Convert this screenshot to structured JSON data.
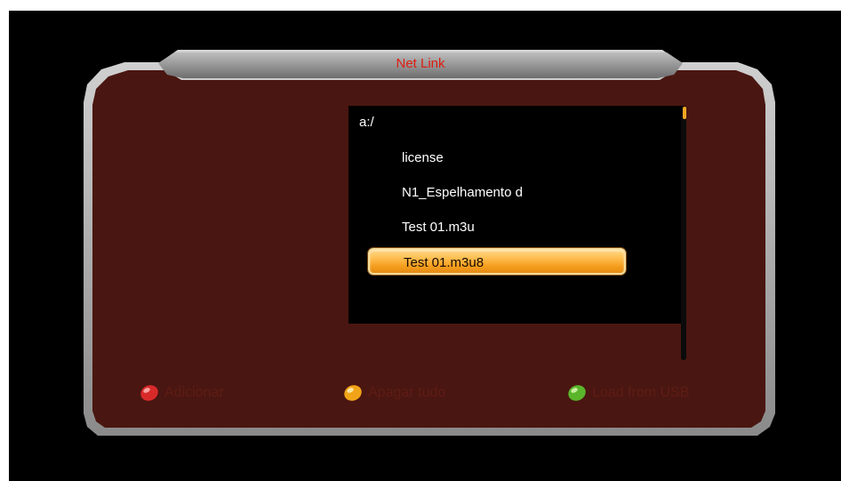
{
  "window": {
    "title": "Net Link"
  },
  "browser": {
    "path": "a:/",
    "files": [
      "license",
      "N1_Espelhamento d",
      "Test 01.m3u",
      "Test 01.m3u8"
    ],
    "selected": "Test 01.m3u8"
  },
  "buttons": {
    "red": {
      "label": "Adicionar",
      "icon": "red-button-icon",
      "color": "#d92a2a"
    },
    "yellow": {
      "label": "Apagar tudo",
      "icon": "yellow-button-icon",
      "color": "#f2a418"
    },
    "green": {
      "label": "Load from USB",
      "icon": "green-button-icon",
      "color": "#5ab52a"
    }
  },
  "colors": {
    "panel": "#4a1611",
    "frame": "#9a9a9a",
    "title": "#e01c10",
    "highlight": "#f5a623"
  }
}
